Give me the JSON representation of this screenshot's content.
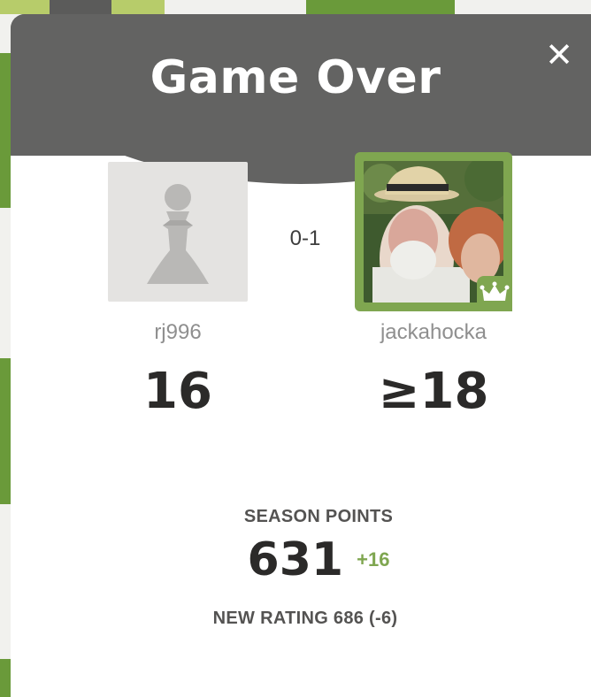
{
  "modal": {
    "title": "Game Over",
    "close_icon": "close-icon"
  },
  "players": {
    "left": {
      "username": "rj996",
      "rating": "16",
      "avatar": "pawn-icon"
    },
    "right": {
      "username": "jackahocka",
      "rating": "≥18",
      "avatar": "user-photo",
      "badge": "crown-icon"
    }
  },
  "result": {
    "score": "0-1"
  },
  "season": {
    "label": "SEASON POINTS",
    "points": "631",
    "delta": "+16"
  },
  "new_rating": "NEW RATING 686 (-6)",
  "colors": {
    "header": "#636362",
    "accent_green": "#7fa650",
    "board_green": "#6a9a3a"
  }
}
